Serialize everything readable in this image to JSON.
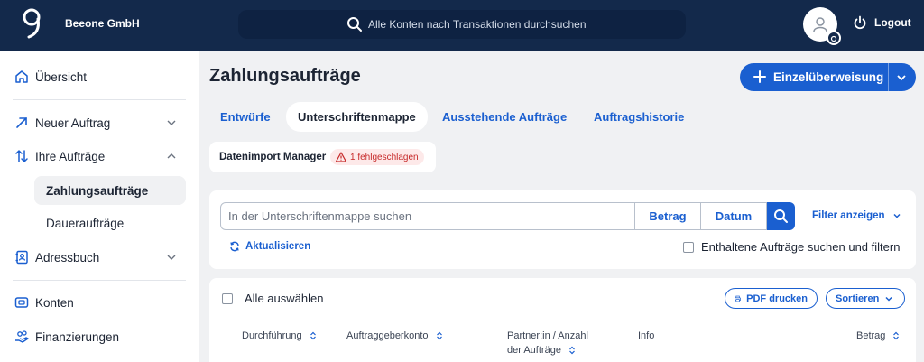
{
  "header": {
    "company": "Beeone GmbH",
    "search_placeholder": "Alle Konten nach Transaktionen durchsuchen",
    "logout_label": "Logout",
    "icons": {
      "logo": "brand-logo",
      "search": "search-icon",
      "avatar": "user-avatar-icon",
      "power": "power-icon"
    }
  },
  "sidebar": {
    "items": [
      {
        "label": "Übersicht",
        "icon": "home-icon"
      },
      {
        "label": "Neuer Auftrag",
        "icon": "arrow-up-right-icon"
      },
      {
        "label": "Ihre Aufträge",
        "icon": "arrows-updown-icon"
      },
      {
        "label": "Zahlungsaufträge",
        "active": true
      },
      {
        "label": "Daueraufträge"
      },
      {
        "label": "Adressbuch",
        "icon": "contact-book-icon"
      },
      {
        "label": "Konten",
        "icon": "wallet-icon"
      },
      {
        "label": "Finanzierungen",
        "icon": "hand-coins-icon"
      }
    ]
  },
  "main": {
    "title": "Zahlungsaufträge",
    "primary_button": "Einzelüberweisung",
    "tabs": [
      "Entwürfe",
      "Unterschriftenmappe",
      "Ausstehende Aufträge",
      "Auftragshistorie"
    ],
    "active_tab": "Unterschriftenmappe",
    "import": {
      "label": "Datenimport Manager",
      "status": "1 fehlgeschlagen"
    },
    "filter": {
      "search_placeholder": "In der Unterschriftenmappe suchen",
      "betrag_label": "Betrag",
      "datum_label": "Datum",
      "filter_toggle": "Filter anzeigen",
      "refresh_label": "Aktualisieren",
      "contained_label": "Enthaltene Aufträge suchen und filtern"
    },
    "list": {
      "select_all": "Alle auswählen",
      "pdf_button": "PDF drucken",
      "sort_button": "Sortieren",
      "columns": {
        "durchfuehrung": "Durchführung",
        "auftraggeberkonto": "Auftraggeberkonto",
        "partner_line1": "Partner:in / Anzahl",
        "partner_line2": "der Aufträge",
        "info": "Info",
        "betrag": "Betrag"
      }
    }
  },
  "colors": {
    "navy": "#13294b",
    "accent": "#1a5fd0",
    "error": "#c62828",
    "background": "#f0f1f3"
  }
}
